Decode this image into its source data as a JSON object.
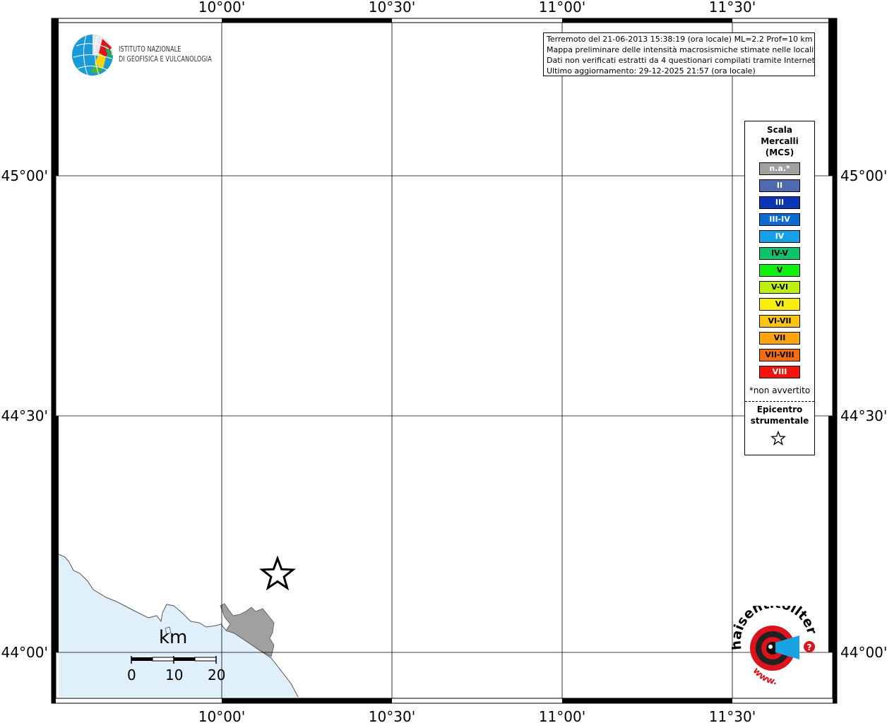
{
  "map": {
    "lon_ticks": [
      "10°00'",
      "10°30'",
      "11°00'",
      "11°30'"
    ],
    "lat_ticks": [
      "45°00'",
      "44°30'",
      "44°00'"
    ],
    "sea_color": "#dff0fb",
    "land_color": "#a0a0a0"
  },
  "info": {
    "line1": "Terremoto del 21-06-2013 15:38:19 (ora locale) ML=2.2 Prof=10 km",
    "line2": "Mappa preliminare delle intensità macrosismiche stimate nelle località",
    "line3": "Dati non verificati estratti da 4 questionari compilati tramite Internet.",
    "line4": "Ultimo aggiornamento: 29-12-2025 21:57 (ora locale)"
  },
  "logo": {
    "line1": "ISTITUTO NAZIONALE",
    "line2": "DI GEOFISICA E VULCANOLOGIA"
  },
  "legend": {
    "title1": "Scala",
    "title2": "Mercalli",
    "title3": "(MCS)",
    "items": [
      {
        "label": "n.a.*",
        "color": "#a0a0a0",
        "text": "#ffffff"
      },
      {
        "label": "II",
        "color": "#4f6bb0",
        "text": "#ffffff"
      },
      {
        "label": "III",
        "color": "#0a36b4",
        "text": "#ffffff"
      },
      {
        "label": "III-IV",
        "color": "#0b6bd4",
        "text": "#ffffff"
      },
      {
        "label": "IV",
        "color": "#16a1e6",
        "text": "#ffffff"
      },
      {
        "label": "IV-V",
        "color": "#10c36a",
        "text": "#000000"
      },
      {
        "label": "V",
        "color": "#0ef00e",
        "text": "#000000"
      },
      {
        "label": "V-VI",
        "color": "#bff00d",
        "text": "#000000"
      },
      {
        "label": "VI",
        "color": "#f7f00f",
        "text": "#000000"
      },
      {
        "label": "VI-VII",
        "color": "#fbc512",
        "text": "#000000"
      },
      {
        "label": "VII",
        "color": "#fba40f",
        "text": "#000000"
      },
      {
        "label": "VII-VIII",
        "color": "#f86a0c",
        "text": "#000000"
      },
      {
        "label": "VIII",
        "color": "#f4120c",
        "text": "#ffffff"
      }
    ],
    "note": "*non avvertito",
    "epicentre1": "Epicentro",
    "epicentre2": "strumentale"
  },
  "scalebar": {
    "unit": "km",
    "labels": [
      "0",
      "10",
      "20"
    ]
  },
  "hsit": {
    "text_top": "haisentitoilterremoto.it",
    "text_bottom": "www.",
    "red": "#d9141c",
    "blue": "#1aa3e3"
  }
}
